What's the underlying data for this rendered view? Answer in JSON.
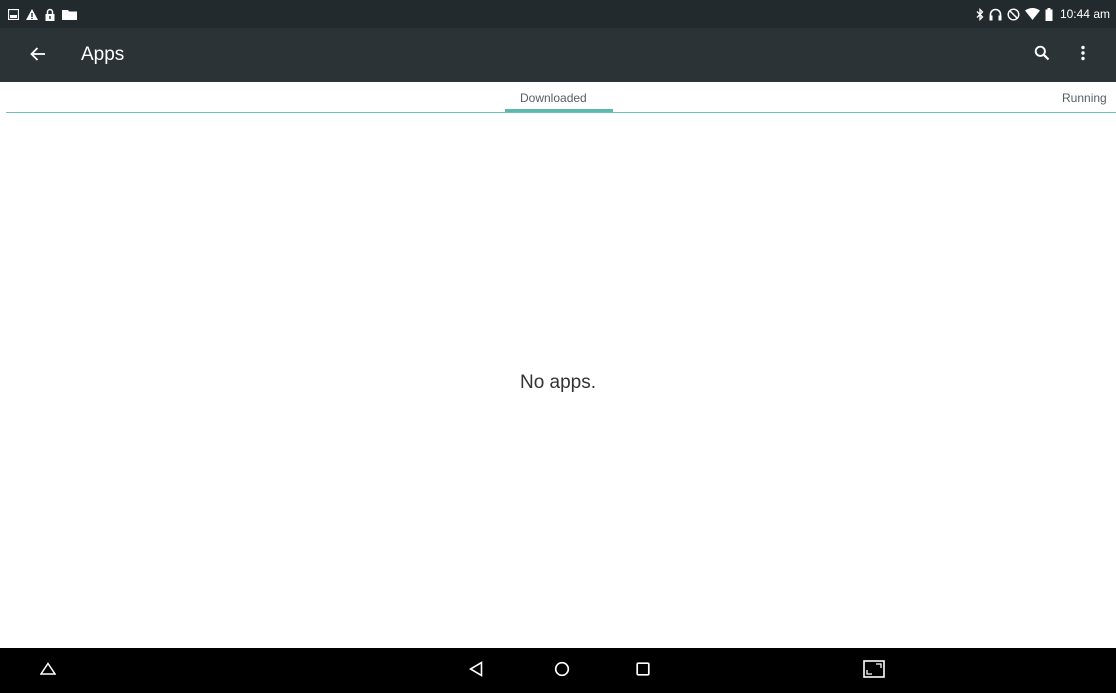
{
  "status_bar": {
    "time": "10:44 am",
    "left_icons": [
      "notification-icon",
      "warning-icon",
      "lock-icon",
      "folder-icon"
    ],
    "right_icons": [
      "bluetooth-icon",
      "headset-icon",
      "do-not-disturb-icon",
      "wifi-icon",
      "battery-icon"
    ]
  },
  "toolbar": {
    "title": "Apps",
    "back_icon": "arrow-back-icon",
    "search_icon": "search-icon",
    "more_icon": "more-vert-icon"
  },
  "tabs": [
    {
      "label": "Downloaded",
      "selected": true
    },
    {
      "label": "Running",
      "selected": false
    }
  ],
  "content": {
    "empty_message": "No apps."
  },
  "nav_bar": {
    "buttons": [
      "nav-up-icon",
      "nav-back-icon",
      "nav-home-icon",
      "nav-recents-icon",
      "screenshot-icon"
    ]
  },
  "colors": {
    "status_bar_bg": "#232a2d",
    "toolbar_bg": "#2b3336",
    "accent": "#5fb8ae",
    "nav_bar_bg": "#000000"
  }
}
